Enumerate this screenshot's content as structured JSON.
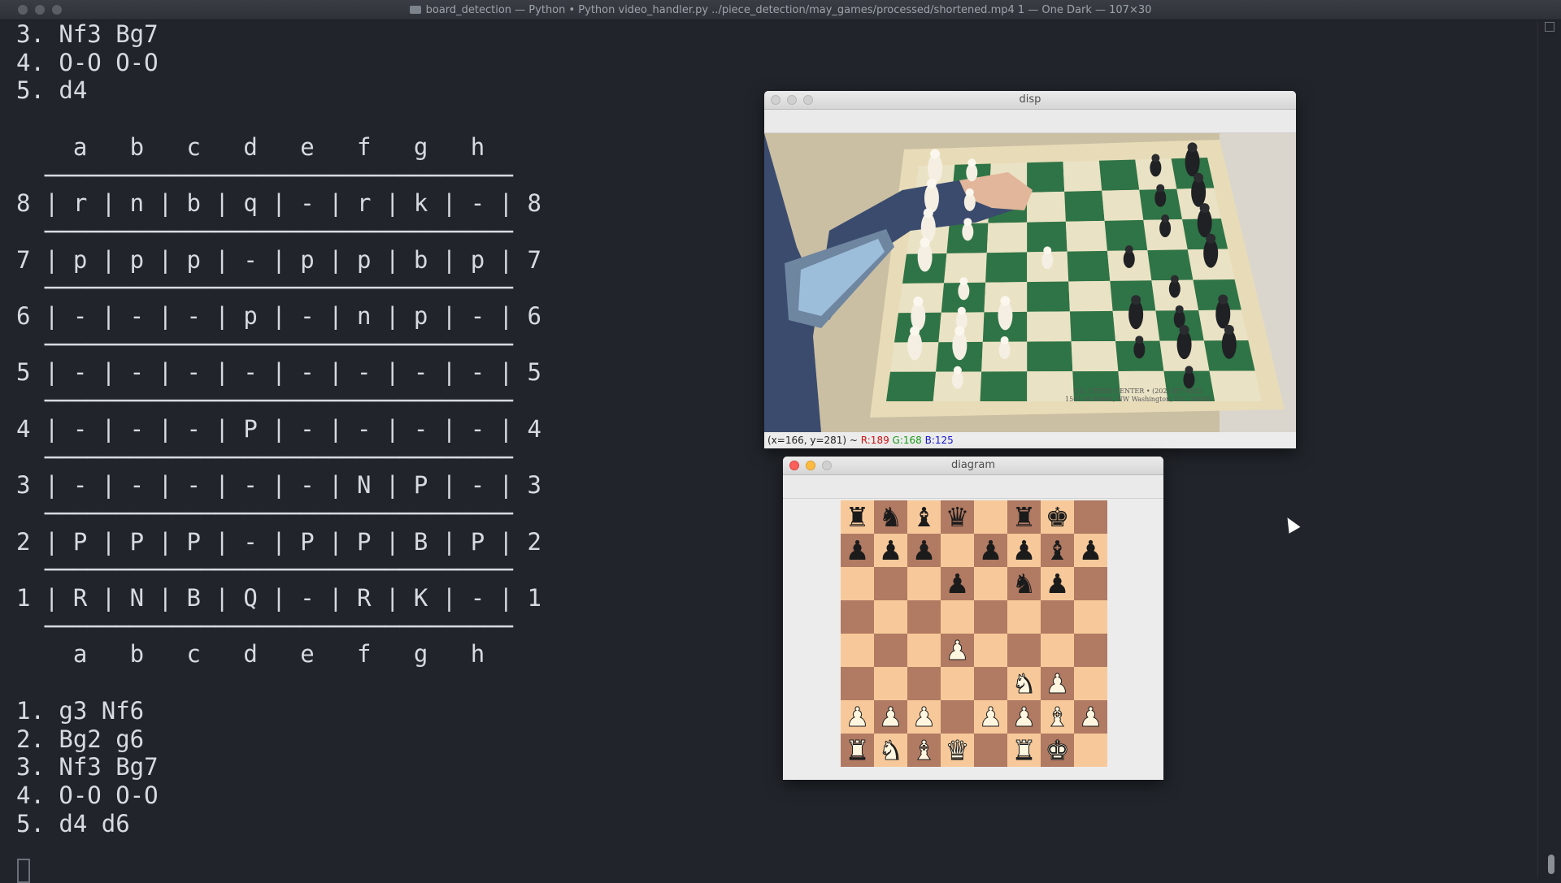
{
  "terminal": {
    "title": "board_detection — Python • Python video_handler.py ../piece_detection/may_games/processed/shortened.mp4 1 — One Dark — 107×30",
    "lines": [
      "3. Nf3 Bg7",
      "4. O-O O-O",
      "5. d4",
      "",
      "    a   b   c   d   e   f   g   h",
      "  ─────────────────────────────────",
      "8 | r | n | b | q | - | r | k | - | 8",
      "  ─────────────────────────────────",
      "7 | p | p | p | - | p | p | b | p | 7",
      "  ─────────────────────────────────",
      "6 | - | - | - | p | - | n | p | - | 6",
      "  ─────────────────────────────────",
      "5 | - | - | - | - | - | - | - | - | 5",
      "  ─────────────────────────────────",
      "4 | - | - | - | P | - | - | - | - | 4",
      "  ─────────────────────────────────",
      "3 | - | - | - | - | - | N | P | - | 3",
      "  ─────────────────────────────────",
      "2 | P | P | P | - | P | P | B | P | 2",
      "  ─────────────────────────────────",
      "1 | R | N | B | Q | - | R | K | - | 1",
      "  ─────────────────────────────────",
      "    a   b   c   d   e   f   g   h",
      "",
      "1. g3 Nf6",
      "2. Bg2 g6",
      "3. Nf3 Bg7",
      "4. O-O O-O",
      "5. d4 d6"
    ]
  },
  "disp_window": {
    "title": "disp",
    "status": {
      "coords": "(x=166, y=281) ~ ",
      "r": "R:189",
      "g": "G:168",
      "b": "B:125"
    },
    "board_print": "U.S. CHESS CENTER • (202) 857-4922",
    "board_print2": "1501 M Street, NW Washington, D.C. 20005"
  },
  "diagram_window": {
    "title": "diagram",
    "board": [
      [
        "r",
        "n",
        "b",
        "q",
        "",
        "r",
        "k",
        ""
      ],
      [
        "p",
        "p",
        "p",
        "",
        "p",
        "p",
        "b",
        "p"
      ],
      [
        "",
        "",
        "",
        "p",
        "",
        "n",
        "p",
        ""
      ],
      [
        "",
        "",
        "",
        "",
        "",
        "",
        "",
        ""
      ],
      [
        "",
        "",
        "",
        "P",
        "",
        "",
        "",
        ""
      ],
      [
        "",
        "",
        "",
        "",
        "",
        "N",
        "P",
        ""
      ],
      [
        "P",
        "P",
        "P",
        "",
        "P",
        "P",
        "B",
        "P"
      ],
      [
        "R",
        "N",
        "B",
        "Q",
        "",
        "R",
        "K",
        ""
      ]
    ]
  }
}
